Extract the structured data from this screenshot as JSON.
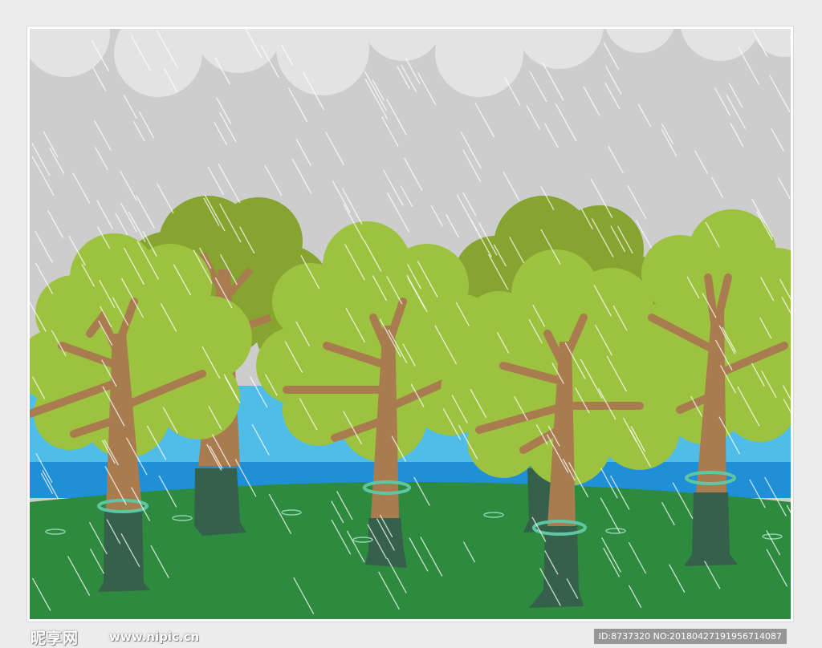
{
  "scene": {
    "title": "",
    "icons": [
      "cloud-icon",
      "rain-icon",
      "tree-icon",
      "puddle-icon"
    ],
    "colors": {
      "sky": "#cdcdcd",
      "cloud": "#e3e3e3",
      "rain": "#ffffff",
      "river": "#4fbde8",
      "river_shore": "#1f8fd6",
      "grass": "#2e8a3e",
      "canopy_light": "#9dc23f",
      "canopy_dark": "#87a431",
      "trunk": "#a97c50",
      "trunk_submerged": "#35614a",
      "water_ring": "#5fc6a4",
      "puddle": "#8ad4a8"
    },
    "tree_count": 7
  },
  "watermark": {
    "logo": "昵享网",
    "url": "www.nipic.cn",
    "id_text": "ID:8737320 NO:20180427191956714087"
  }
}
